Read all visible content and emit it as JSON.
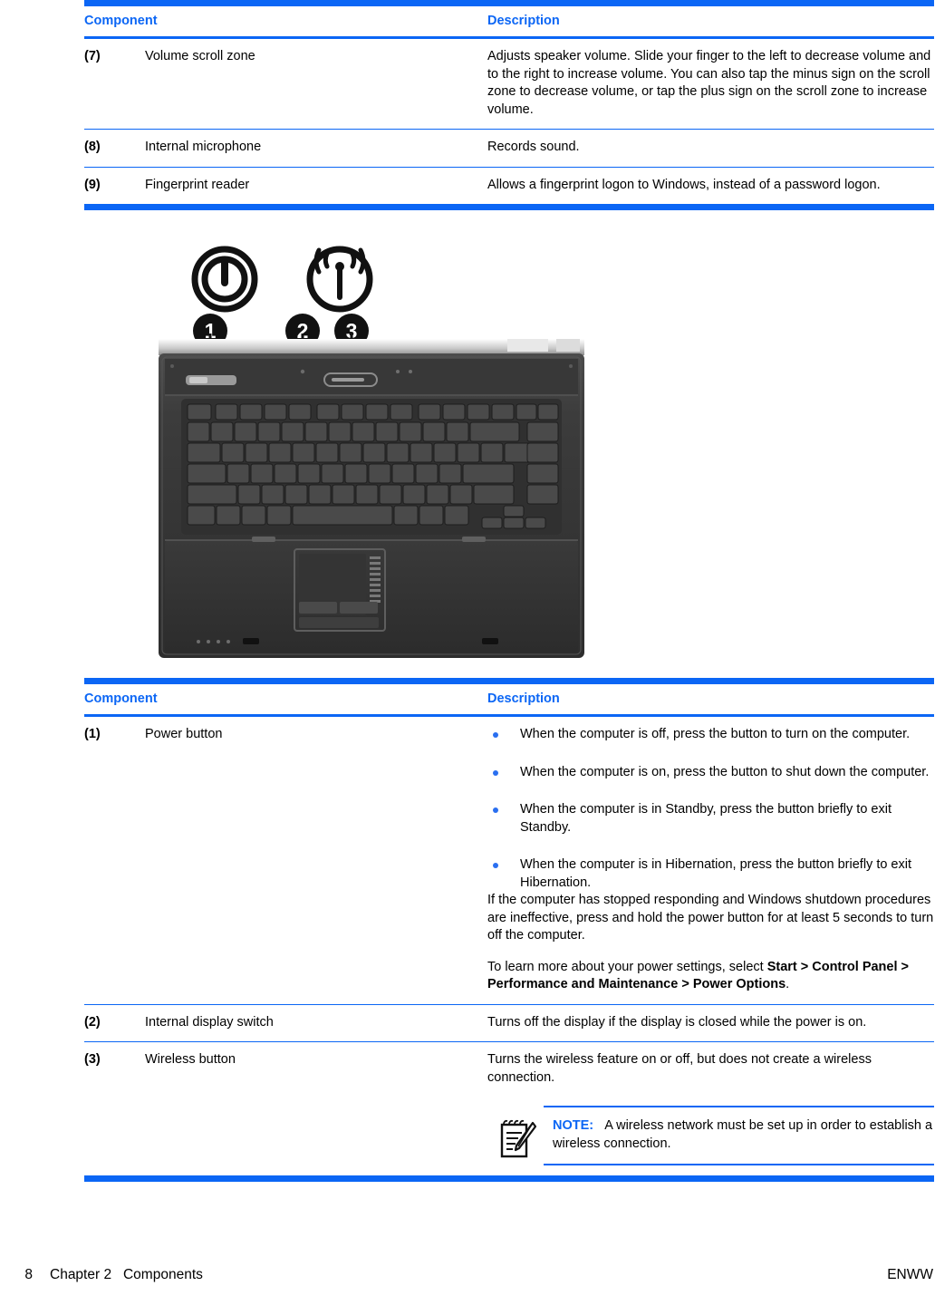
{
  "colors": {
    "accent_blue": "#0b66f5",
    "bullet_blue": "#2a6ff0",
    "text_black": "#000000"
  },
  "table_top": {
    "headers": {
      "component": "Component",
      "description": "Description"
    },
    "rows": [
      {
        "num": "(7)",
        "component": "Volume scroll zone",
        "description": "Adjusts speaker volume. Slide your finger to the left to decrease volume and to the right to increase volume. You can also tap the minus sign on the scroll zone to decrease volume, or tap the plus sign on the scroll zone to increase volume."
      },
      {
        "num": "(8)",
        "component": "Internal microphone",
        "description": "Records sound."
      },
      {
        "num": "(9)",
        "component": "Fingerprint reader",
        "description": "Allows a fingerprint logon to Windows, instead of a password logon."
      }
    ]
  },
  "figure": {
    "caption_icons": [
      {
        "name": "power-icon",
        "label": "power symbol"
      },
      {
        "name": "wireless-icon",
        "label": "wireless antenna symbol"
      }
    ],
    "callouts": [
      "1",
      "2",
      "3"
    ],
    "alt": "Top view of notebook computer keyboard showing power button, internal display switch, and wireless button"
  },
  "table_bottom": {
    "headers": {
      "component": "Component",
      "description": "Description"
    },
    "rows": [
      {
        "num": "(1)",
        "component": "Power button",
        "bullets": [
          "When the computer is off, press the button to turn on the computer.",
          "When the computer is on, press the button to shut down the computer.",
          "When the computer is in Standby, press the button briefly to exit Standby.",
          "When the computer is in Hibernation, press the button briefly to exit Hibernation."
        ],
        "paragraph1": "If the computer has stopped responding and Windows shutdown procedures are ineffective, press and hold the power button for at least 5 seconds to turn off the computer.",
        "paragraph2_lead": "To learn more about your power settings, select ",
        "paragraph2_bold": "Start > Control Panel > Performance and Maintenance > Power Options",
        "paragraph2_tail": "."
      },
      {
        "num": "(2)",
        "component": "Internal display switch",
        "description": "Turns off the display if the display is closed while the power is on."
      },
      {
        "num": "(3)",
        "component": "Wireless button",
        "description": "Turns the wireless feature on or off, but does not create a wireless connection.",
        "note": {
          "label": "NOTE:",
          "text": "A wireless network must be set up in order to establish a wireless connection.",
          "icon": "note-pencil-icon"
        }
      }
    ]
  },
  "footer": {
    "page_number": "8",
    "chapter": "Chapter 2   Components",
    "locale": "ENWW"
  }
}
